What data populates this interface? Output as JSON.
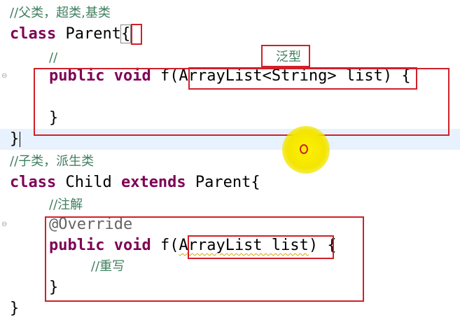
{
  "code": {
    "comment_parent": "//父类，超类,基类",
    "kw_class": "class",
    "parent_name": " Parent",
    "brace_open": "{",
    "comment_empty": "//",
    "kw_public": "public",
    "kw_void": "void",
    "method_f_open": " f(",
    "generic_param": "ArrayList<String> list",
    "paren_close_brace": ") {",
    "inner_close": "}",
    "outer_close": "}",
    "comment_child": "//子类，派生类",
    "child_name": " Child ",
    "kw_extends": "extends",
    "extends_parent": " Parent{",
    "comment_annotation": "//注解",
    "annotation": "@Override",
    "raw_param": "ArrayList list",
    "comment_override": "//重写"
  },
  "annotations": {
    "generic_label": "泛型"
  },
  "colors": {
    "keyword": "#7f0055",
    "comment": "#3f7f5f",
    "annotation_box": "#d0202a",
    "current_line": "#e8f2fe",
    "cursor_highlight": "#fff200"
  },
  "icons": [
    "fold-marker-icon",
    "mouse-cursor-highlight-icon"
  ]
}
